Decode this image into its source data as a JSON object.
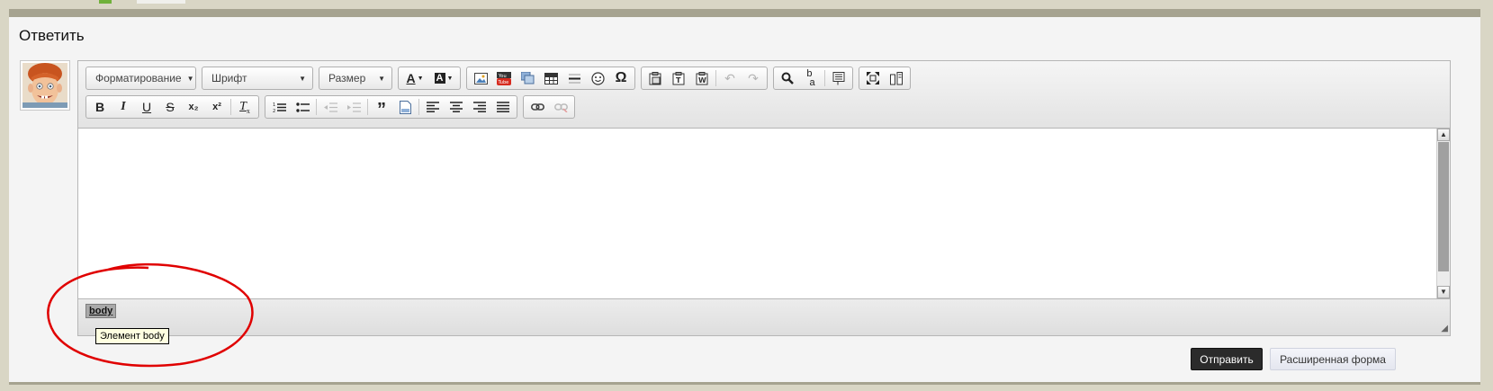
{
  "reply": {
    "title": "Ответить"
  },
  "toolbar": {
    "format_label": "Форматирование",
    "font_label": "Шрифт",
    "size_label": "Размер",
    "superscript": "x²",
    "subscript": "x₂"
  },
  "editor": {
    "path_tag": "body",
    "tooltip": "Элемент body"
  },
  "actions": {
    "submit_label": "Отправить",
    "advanced_label": "Расширенная форма"
  },
  "colors": {
    "accent_bar": "#a6a390",
    "submit_bg": "#2b2b2b",
    "annotation": "#e00000"
  },
  "icons": [
    "text-color-icon",
    "background-color-icon",
    "image-icon",
    "youtube-icon",
    "flash-icon",
    "table-icon",
    "horizontal-line-icon",
    "smiley-icon",
    "special-char-icon",
    "paste-icon",
    "paste-text-icon",
    "paste-word-icon",
    "undo-icon",
    "redo-icon",
    "find-icon",
    "replace-icon",
    "select-all-icon",
    "maximize-icon",
    "source-icon",
    "bold-icon",
    "italic-icon",
    "underline-icon",
    "strike-icon",
    "subscript-icon",
    "superscript-icon",
    "remove-format-icon",
    "numbered-list-icon",
    "bulleted-list-icon",
    "outdent-icon",
    "indent-icon",
    "blockquote-icon",
    "create-div-icon",
    "align-left-icon",
    "align-center-icon",
    "align-right-icon",
    "justify-icon",
    "link-icon",
    "unlink-icon"
  ]
}
